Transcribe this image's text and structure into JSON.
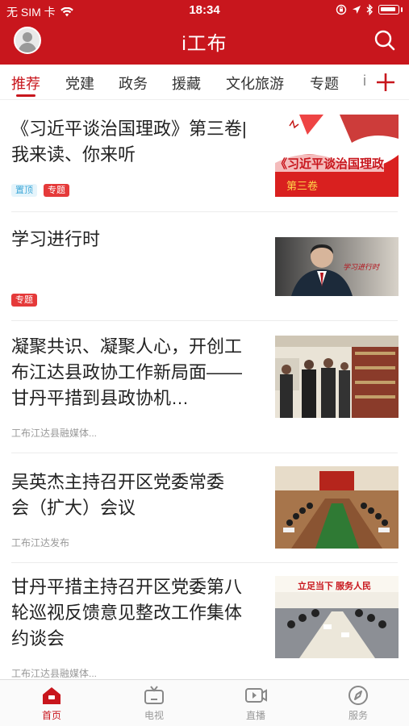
{
  "status_bar": {
    "carrier": "无 SIM 卡",
    "time": "18:34"
  },
  "header": {
    "title": "i工布"
  },
  "tabs": [
    "推荐",
    "党建",
    "政务",
    "援藏",
    "文化旅游",
    "专题",
    "i"
  ],
  "news": [
    {
      "title": "《习近平谈治国理政》第三卷|我来读、你来听",
      "tags": [
        "置顶",
        "专题"
      ],
      "source": "",
      "thumb_text": "《习近平谈治国理政",
      "thumb_text2": "第三卷"
    },
    {
      "title": "学习进行时",
      "tags": [
        "专题"
      ],
      "source": "",
      "thumb_text": "学习进行时"
    },
    {
      "title": "凝聚共识、凝聚人心，开创工布江达县政协工作新局面——甘丹平措到县政协机…",
      "tags": [],
      "source": "工布江达县融媒体..."
    },
    {
      "title": "吴英杰主持召开区党委常委会（扩大）会议",
      "tags": [],
      "source": "工布江达发布"
    },
    {
      "title": "甘丹平措主持召开区党委第八轮巡视反馈意见整改工作集体约谈会",
      "tags": [],
      "source": "工布江达县融媒体...",
      "thumb_text": "立足当下 服务人民"
    }
  ],
  "bottom_nav": [
    {
      "label": "首页",
      "icon": "home-icon",
      "active": true
    },
    {
      "label": "电视",
      "icon": "tv-icon",
      "active": false
    },
    {
      "label": "直播",
      "icon": "live-video-icon",
      "active": false
    },
    {
      "label": "服务",
      "icon": "compass-icon",
      "active": false
    }
  ],
  "colors": {
    "brand": "#c8161d",
    "tag_top": "#3ea8d8",
    "tag_topic": "#e53a3a"
  }
}
